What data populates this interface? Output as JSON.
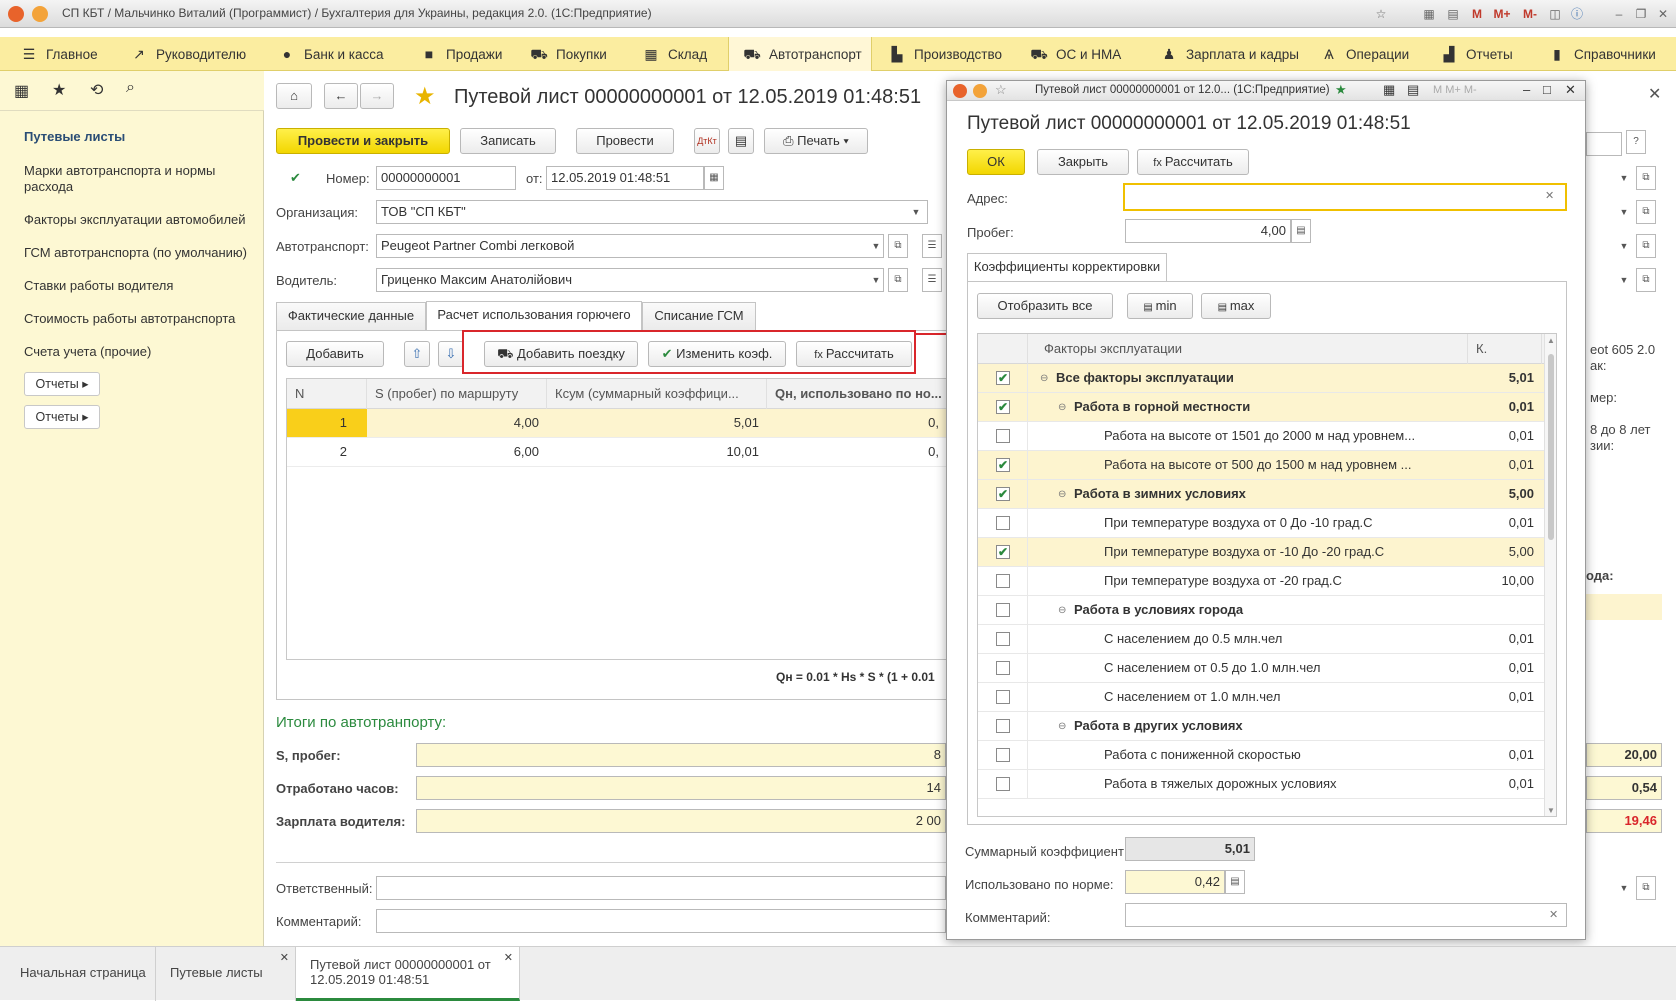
{
  "window": {
    "title": "СП КБТ / Мальчинко Виталий (Программист) / Бухгалтерия для Украины, редакция 2.0.  (1С:Предприятие)"
  },
  "sections": [
    {
      "label": "Главное",
      "icon": "menu-icon"
    },
    {
      "label": "Руководителю",
      "icon": "trend-icon"
    },
    {
      "label": "Банк и касса",
      "icon": "coin-icon"
    },
    {
      "label": "Продажи",
      "icon": "bag-icon"
    },
    {
      "label": "Покупки",
      "icon": "cart-icon"
    },
    {
      "label": "Склад",
      "icon": "grid-icon"
    },
    {
      "label": "Автотранспорт",
      "icon": "truck-icon"
    },
    {
      "label": "Производство",
      "icon": "factory-icon"
    },
    {
      "label": "ОС и НМА",
      "icon": "truck-icon"
    },
    {
      "label": "Зарплата и кадры",
      "icon": "people-icon"
    },
    {
      "label": "Операции",
      "icon": "dtkt-icon"
    },
    {
      "label": "Отчеты",
      "icon": "barchart-icon"
    },
    {
      "label": "Справочники",
      "icon": "book-icon"
    }
  ],
  "left_nav": {
    "items": [
      "Путевые листы",
      "Марки автотранспорта и нормы расхода",
      "Факторы эксплуатации автомобилей",
      "ГСМ автотранспорта (по умолчанию)",
      "Ставки работы водителя",
      "Стоимость работы автотранспорта",
      "Счета учета (прочие)"
    ],
    "report_buttons": [
      "Отчеты ▸",
      "Отчеты ▸"
    ]
  },
  "doc": {
    "title": "Путевой лист 00000000001 от 12.05.2019 01:48:51",
    "buttons": {
      "post_close": "Провести и закрыть",
      "save": "Записать",
      "post": "Провести",
      "print": "Печать"
    },
    "number_label": "Номер:",
    "number": "00000000001",
    "date_label": "от:",
    "date": "12.05.2019 01:48:51",
    "org_label": "Организация:",
    "org": "ТОВ \"СП КБТ\"",
    "vehicle_label": "Автотранспорт:",
    "vehicle": "Peugeot Partner Combi легковой",
    "driver_label": "Водитель:",
    "driver": "Гриценко Максим Анатолійович",
    "tabs": [
      "Фактические данные",
      "Расчет использования горючего",
      "Списание ГСМ"
    ],
    "table_buttons": {
      "add": "Добавить",
      "add_trip": "Добавить поездку",
      "change_coef": "Изменить коэф.",
      "calculate": "Рассчитать"
    },
    "columns": [
      "N",
      "S (пробег) по маршруту",
      "Ксум (суммарный коэффици...",
      "Qн, использовано по но..."
    ],
    "rows": [
      {
        "n": "1",
        "s": "4,00",
        "k": "5,01",
        "q": "0,"
      },
      {
        "n": "2",
        "s": "6,00",
        "k": "10,01",
        "q": "0,"
      }
    ],
    "formula": "Qн = 0.01 * Hs * S * (1 + 0.01",
    "totals_title": "Итоги по автотранпорту:",
    "totals": [
      {
        "label": "S, пробег:",
        "value": "8"
      },
      {
        "label": "Отработано часов:",
        "value": "14"
      },
      {
        "label": "Зарплата водителя:",
        "value": "2 00"
      }
    ],
    "responsible_label": "Ответственный:",
    "comment_label": "Комментарий:",
    "right_fragments": {
      "vehicle_text": "eot 605 2.0",
      "line2": "ак:",
      "line3": "мер:",
      "line4": "8 до 8 лет",
      "line5": "зии:",
      "line6": "ода:",
      "val1": "20,00",
      "val2": "0,54",
      "val3": "19,46"
    }
  },
  "dialog": {
    "window_title": "Путевой лист 00000000001 от 12.0...  (1С:Предприятие)",
    "title": "Путевой лист 00000000001 от 12.05.2019 01:48:51",
    "buttons": {
      "ok": "ОК",
      "close": "Закрыть",
      "calculate": "Рассчитать"
    },
    "address_label": "Адрес:",
    "address": "",
    "mileage_label": "Пробег:",
    "mileage": "4,00",
    "tab": "Коэффициенты корректировки",
    "list_buttons": {
      "show_all": "Отобразить все",
      "min": "min",
      "max": "max"
    },
    "columns": [
      "Факторы эксплуатации",
      "К."
    ],
    "factors": [
      {
        "checked": true,
        "level": 0,
        "group": true,
        "name": "Все факторы эксплуатации",
        "k": "5,01",
        "hl": true
      },
      {
        "checked": true,
        "level": 1,
        "group": true,
        "name": "Работа в горной местности",
        "k": "0,01",
        "hl": true
      },
      {
        "checked": false,
        "level": 2,
        "group": false,
        "name": "Работа на высоте от 1501 до 2000 м над уровнем...",
        "k": "0,01",
        "hl": false
      },
      {
        "checked": true,
        "level": 2,
        "group": false,
        "name": "Работа на высоте от 500 до 1500 м над уровнем ...",
        "k": "0,01",
        "hl": true
      },
      {
        "checked": true,
        "level": 1,
        "group": true,
        "name": "Работа в зимних условиях",
        "k": "5,00",
        "hl": true
      },
      {
        "checked": false,
        "level": 2,
        "group": false,
        "name": "При температуре воздуха  от 0 До -10 град.С",
        "k": "0,01",
        "hl": false
      },
      {
        "checked": true,
        "level": 2,
        "group": false,
        "name": "При температуре воздуха от -10 До -20 град.С",
        "k": "5,00",
        "hl": true
      },
      {
        "checked": false,
        "level": 2,
        "group": false,
        "name": "При температуре воздуха от -20 град.С",
        "k": "10,00",
        "hl": false
      },
      {
        "checked": false,
        "level": 1,
        "group": true,
        "name": "Работа в условиях города",
        "k": "",
        "hl": false
      },
      {
        "checked": false,
        "level": 2,
        "group": false,
        "name": "С населением до 0.5 млн.чел",
        "k": "0,01",
        "hl": false
      },
      {
        "checked": false,
        "level": 2,
        "group": false,
        "name": "С населением от 0.5 до 1.0 млн.чел",
        "k": "0,01",
        "hl": false
      },
      {
        "checked": false,
        "level": 2,
        "group": false,
        "name": "С населением от 1.0 млн.чел",
        "k": "0,01",
        "hl": false
      },
      {
        "checked": false,
        "level": 1,
        "group": true,
        "name": "Работа в других условиях",
        "k": "",
        "hl": false
      },
      {
        "checked": false,
        "level": 2,
        "group": false,
        "name": "Работа с пониженной скоростью",
        "k": "0,01",
        "hl": false
      },
      {
        "checked": false,
        "level": 2,
        "group": false,
        "name": "Работа в тяжелых дорожных условиях",
        "k": "0,01",
        "hl": false
      }
    ],
    "sum_label": "Суммарный коэффициент:",
    "sum": "5,01",
    "norm_label": "Использовано по норме:",
    "norm": "0,42",
    "comment_label": "Комментарий:"
  },
  "bottom_tabs": [
    {
      "label": "Начальная страница"
    },
    {
      "label": "Путевые листы"
    },
    {
      "label": "Путевой лист 00000000001 от 12.05.2019 01:48:51"
    }
  ],
  "colors": {
    "accent_yellow": "#f2d600",
    "panel_yellow": "#fdf8d3",
    "highlight_red": "#d9262b",
    "active_green": "#2b8a3e"
  }
}
